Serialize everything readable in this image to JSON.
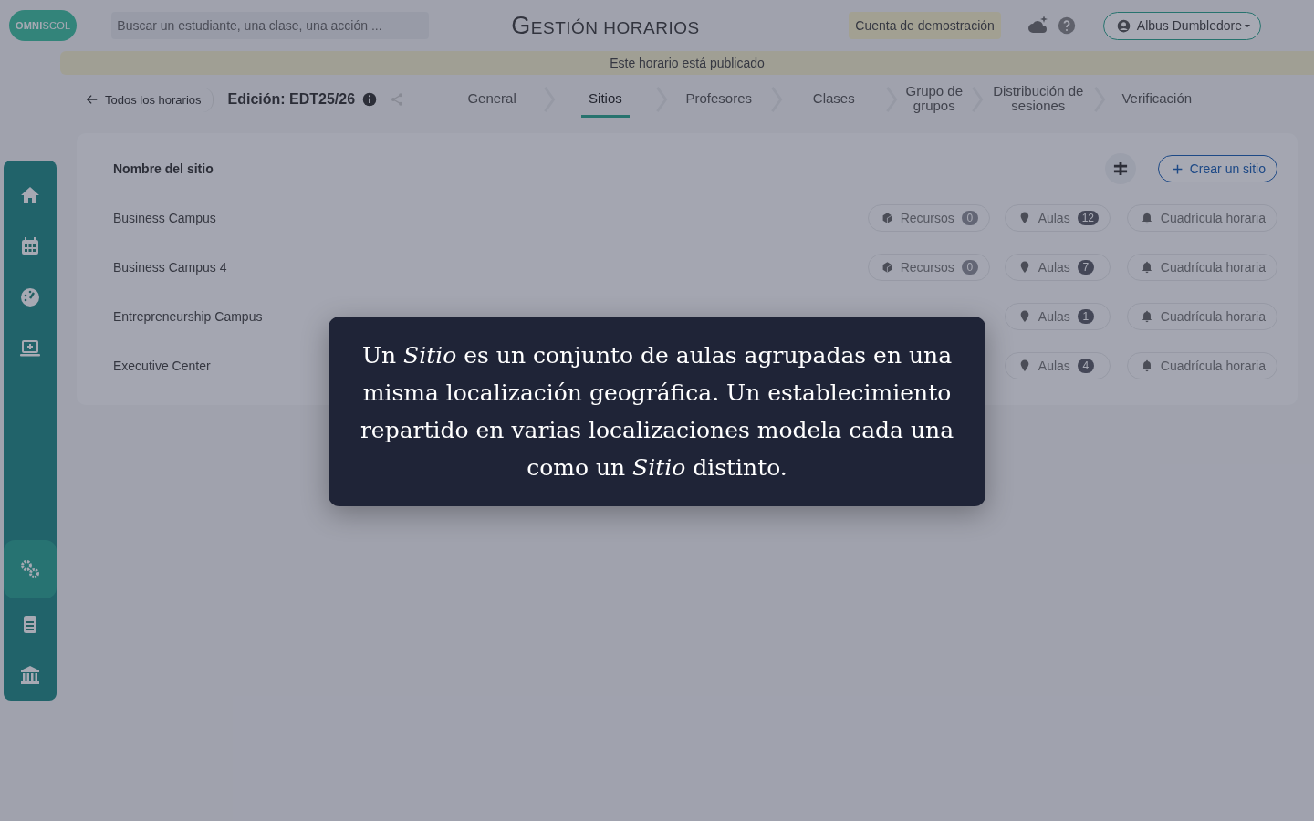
{
  "header": {
    "logo": "**OMNI**SCOL",
    "search": {
      "placeholder": "Buscar un estudiante, una clase, una acción ..."
    },
    "title": "GESTIÓN HORARIOS",
    "demo_badge": "Cuenta de demostración",
    "user": "Albus Dumbledore"
  },
  "banner": "Este horario está publicado",
  "nav": {
    "back": "Todos los horarios",
    "edition": "Edición: EDT25/26",
    "steps": [
      {
        "label": "General",
        "selected": false
      },
      {
        "label": "Sitios",
        "selected": true
      },
      {
        "label": "Profesores",
        "selected": false
      },
      {
        "label": "Clases",
        "selected": false
      },
      {
        "label": "Grupo de grupos",
        "selected": false
      },
      {
        "label": "Distribución de sesiones",
        "selected": false
      },
      {
        "label": "Verificación",
        "selected": false
      }
    ]
  },
  "sidebar": {
    "items": [
      {
        "kind": "home",
        "selected": false
      },
      {
        "kind": "calendar",
        "selected": false
      },
      {
        "kind": "gauge",
        "selected": false
      },
      {
        "kind": "laptop",
        "selected": false
      },
      {
        "kind": "gears",
        "selected": true
      },
      {
        "kind": "clipboard",
        "selected": false
      },
      {
        "kind": "bank",
        "selected": false
      }
    ]
  },
  "table": {
    "heading": "Nombre del sitio",
    "create_button": "Crear un sitio",
    "rows": [
      {
        "name": "Business Campus",
        "chips": [
          {
            "kind": "resources",
            "label": "Recursos",
            "count": "0"
          },
          {
            "kind": "rooms",
            "label": "Aulas",
            "count": "12"
          },
          {
            "kind": "grid",
            "label": "Cuadrícula horaria"
          }
        ]
      },
      {
        "name": "Business Campus 4",
        "chips": [
          {
            "kind": "resources",
            "label": "Recursos",
            "count": "0"
          },
          {
            "kind": "rooms",
            "label": "Aulas",
            "count": "7"
          },
          {
            "kind": "grid",
            "label": "Cuadrícula horaria"
          }
        ]
      },
      {
        "name": "Entrepreneurship Campus",
        "chips": [
          {
            "kind": "rooms",
            "label": "Aulas",
            "count": "1"
          },
          {
            "kind": "grid",
            "label": "Cuadrícula horaria"
          }
        ]
      },
      {
        "name": "Executive Center",
        "chips": [
          {
            "kind": "rooms",
            "label": "Aulas",
            "count": "4"
          },
          {
            "kind": "grid",
            "label": "Cuadrícula horaria"
          }
        ]
      }
    ]
  },
  "tooltip": "Un *Sitio* es un conjunto de aulas agrupadas en una misma localización geográfica. Un establecimiento repartido en varias localizaciones modela cada una como un *Sitio* distinto."
}
